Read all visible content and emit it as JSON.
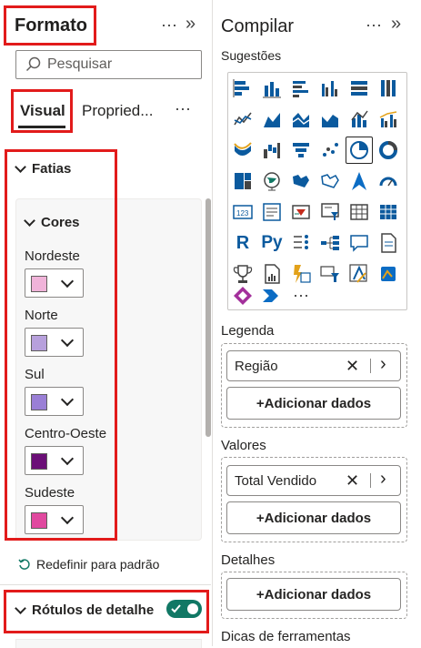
{
  "format_pane": {
    "title": "Formato",
    "header_icons": [
      "more-icon",
      "expand-icon"
    ],
    "search": {
      "placeholder": "Pesquisar"
    },
    "tabs": [
      {
        "label": "Visual",
        "active": true
      },
      {
        "label": "Propried..."
      }
    ],
    "tabs_more": "⋯",
    "sections": {
      "fatias": {
        "label": "Fatias",
        "expanded": true
      },
      "cores": {
        "label": "Cores",
        "expanded": true
      },
      "colors": [
        {
          "label": "Nordeste",
          "color": "#f0b3d9"
        },
        {
          "label": "Norte",
          "color": "#b7a0dc"
        },
        {
          "label": "Sul",
          "color": "#9a7fd6"
        },
        {
          "label": "Centro-Oeste",
          "color": "#6b0f77"
        },
        {
          "label": "Sudeste",
          "color": "#e0499f"
        }
      ],
      "reset": "Redefinir para padrão",
      "rotulos": {
        "label": "Rótulos de detalhe",
        "toggle_on": true
      }
    }
  },
  "build_pane": {
    "title": "Compilar",
    "suggestions_label": "Sugestões",
    "visual_icons": [
      "stacked-bar-icon",
      "stacked-column-icon",
      "clustered-bar-icon",
      "clustered-column-icon",
      "100-bar-icon",
      "100-column-icon",
      "line-chart-icon",
      "area-chart-icon",
      "stacked-area-icon",
      "ribbon-area-icon",
      "line-column-icon",
      "line-clustered-column-icon",
      "ribbon-chart-icon",
      "waterfall-icon",
      "funnel-icon",
      "scatter-icon",
      "pie-chart-icon",
      "donut-chart-icon",
      "treemap-icon",
      "map-icon",
      "filled-map-icon",
      "shape-map-icon",
      "azure-map-icon",
      "gauge-icon",
      "card-icon",
      "multirow-card-icon",
      "kpi-icon",
      "slicer-icon",
      "table-icon",
      "matrix-icon",
      "r-visual-icon",
      "python-visual-icon",
      "key-influencers-icon",
      "decomposition-tree-icon",
      "qa-icon",
      "smart-narrative-icon",
      "trophy-icon",
      "paginated-report-icon",
      "power-apps-icon",
      "metrics-icon",
      "power-automate-icon",
      "power-apps-alt-icon",
      "powerapps-diamond-icon",
      "power-automate-arrow-icon",
      "more-visuals-icon"
    ],
    "wells": {
      "legenda": {
        "label": "Legenda",
        "field": "Região",
        "add": "+Adicionar dados"
      },
      "valores": {
        "label": "Valores",
        "field": "Total Vendido",
        "add": "+Adicionar dados"
      },
      "detalhes": {
        "label": "Detalhes",
        "add": "+Adicionar dados"
      },
      "dicas": {
        "label": "Dicas de ferramentas"
      }
    }
  },
  "colors": {
    "accent_red": "#e21b1b",
    "toggle_green": "#117865",
    "selected_border": "#252423"
  }
}
